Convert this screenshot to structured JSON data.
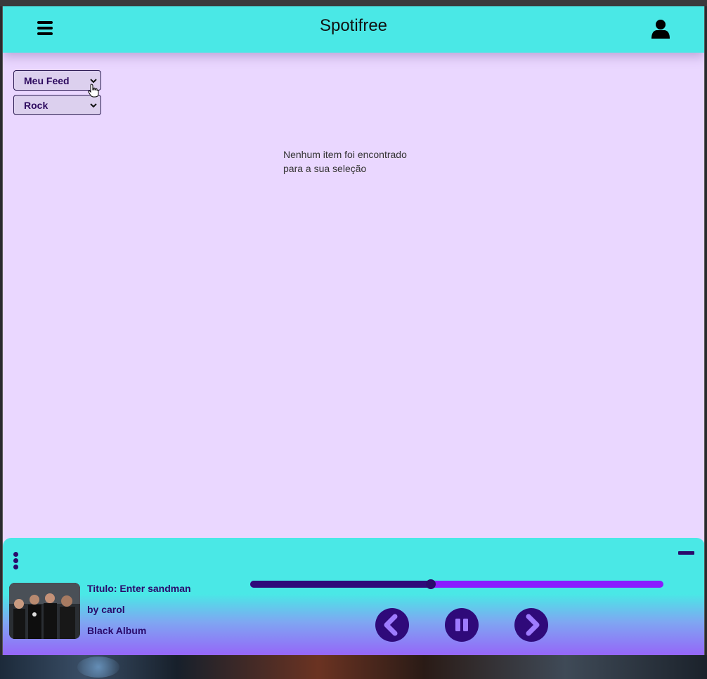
{
  "header": {
    "app_title": "Spotifree",
    "menu_icon": "hamburger-menu-icon",
    "user_icon": "user-profile-icon"
  },
  "filters": {
    "feed_select": {
      "selected": "Meu Feed"
    },
    "genre_select": {
      "selected": "Rock"
    }
  },
  "main": {
    "empty_message_line1": "Nenhum item foi encontrado",
    "empty_message_line2": "para a sua seleção"
  },
  "player": {
    "title": "Titulo: Enter sandman",
    "artist": "by carol",
    "album": "Black Album",
    "progress_fraction": 0.437,
    "controls": {
      "prev_icon": "chevron-left-icon",
      "pause_icon": "pause-icon",
      "next_icon": "chevron-right-icon",
      "more_icon": "vertical-dots-icon",
      "minimize_icon": "minus-icon"
    }
  },
  "colors": {
    "header_bg": "#4ae8e6",
    "page_bg": "#ead7ff",
    "player_dark": "#2f0a7a",
    "player_accent": "#8a1cff",
    "text_purple": "#2a0a6b"
  }
}
